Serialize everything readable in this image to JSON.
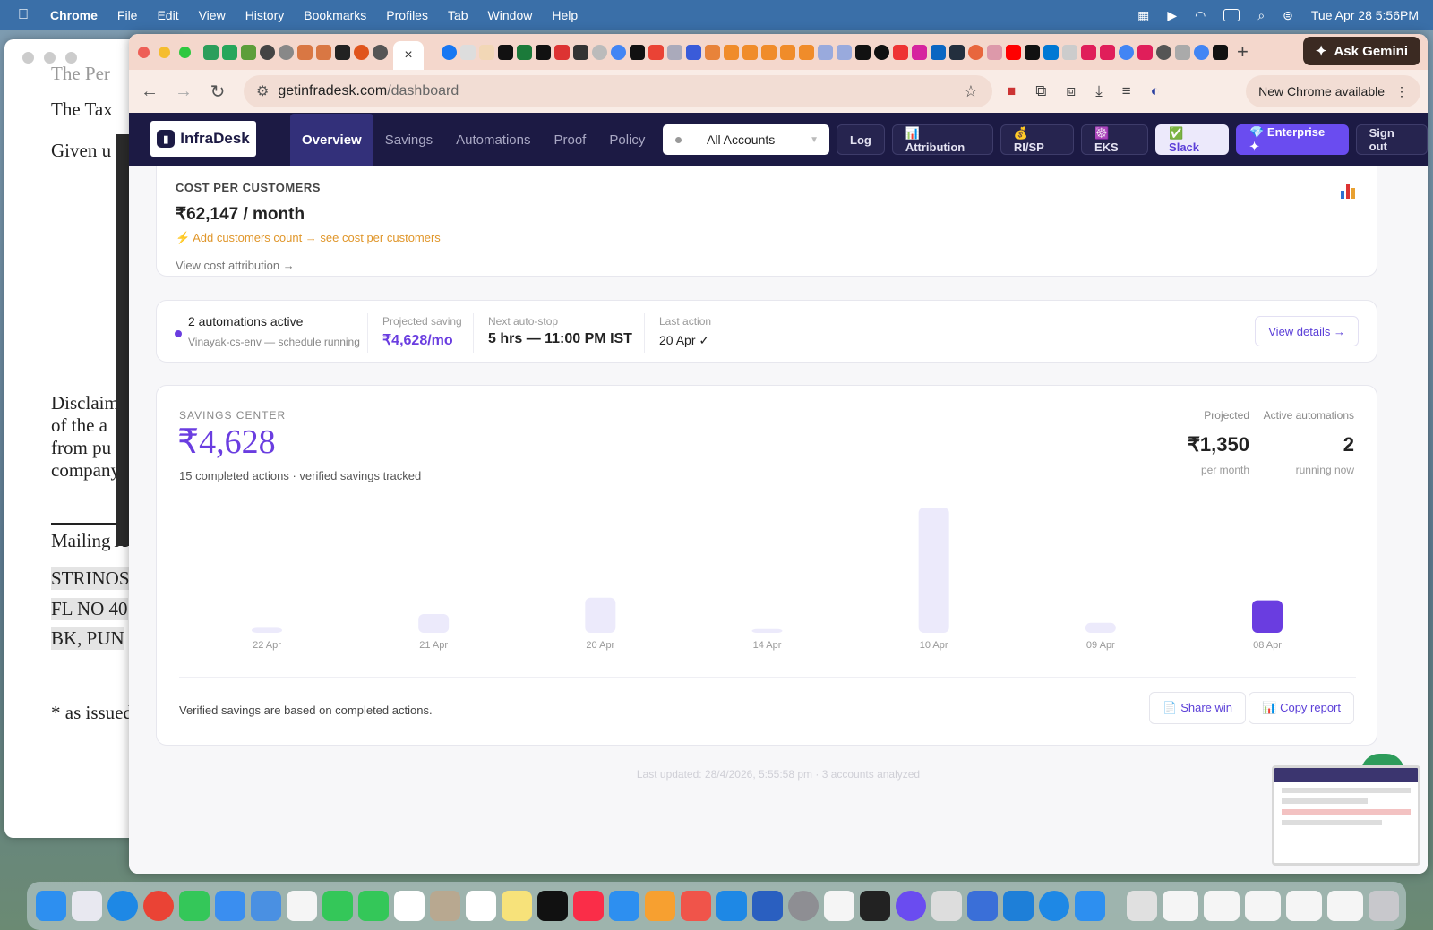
{
  "menubar": {
    "app": "Chrome",
    "items": [
      "File",
      "Edit",
      "View",
      "History",
      "Bookmarks",
      "Profiles",
      "Tab",
      "Window",
      "Help"
    ],
    "clock": "Tue Apr 28  5:56PM"
  },
  "docwin": {
    "lines": [
      "The Per",
      "The Tax",
      "Given u",
      "Disclaim",
      "of the a",
      "from pu",
      "company",
      "Mailing A",
      "STRINOS",
      "FL NO 40",
      "BK, PUN",
      "* as issued"
    ]
  },
  "chrome": {
    "url_host": "getinfradesk.com",
    "url_path": "/dashboard",
    "ask_gemini": "Ask Gemini",
    "new_chrome": "New Chrome available",
    "tab_close": "×",
    "new_tab": "+"
  },
  "nav": {
    "logo": "InfraDesk",
    "tabs": [
      "Overview",
      "Savings",
      "Automations",
      "Proof",
      "Policy"
    ],
    "account_select": "All Accounts",
    "buttons": [
      "Log",
      "📊 Attribution",
      "💰 RI/SP",
      "☸️ EKS",
      "✅ Slack",
      "💎 Enterprise ✦",
      "Sign out"
    ]
  },
  "cost_card": {
    "label": "COST PER CUSTOMERS",
    "amount": "₹62,147 / month",
    "hint": "⚡ Add customers count → see cost per customers",
    "link": "View cost attribution →"
  },
  "automation_card": {
    "title": "2 automations active",
    "subtitle": "Vinayak-cs-env — schedule running",
    "projected_label": "Projected saving",
    "projected_value": "₹4,628/mo",
    "next_label": "Next auto-stop",
    "next_value": "5 hrs — 11:00 PM IST",
    "last_label": "Last action",
    "last_value": "20 Apr ✓",
    "button": "View details →"
  },
  "savings": {
    "label": "SAVINGS CENTER",
    "amount": "₹4,628",
    "sub": "15 completed actions · verified savings tracked",
    "projected_label": "Projected",
    "projected_value": "₹1,350",
    "projected_unit": "per month",
    "active_label": "Active automations",
    "active_value": "2",
    "active_unit": "running now",
    "footer": "Verified savings are based on completed actions.",
    "share_btn": "📄 Share win",
    "copy_btn": "📊 Copy report",
    "colors": {
      "bar": "#eceafb",
      "highlight": "#6a3de0"
    }
  },
  "chart_data": {
    "type": "bar",
    "categories": [
      "22 Apr",
      "21 Apr",
      "20 Apr",
      "14 Apr",
      "10 Apr",
      "09 Apr",
      "08 Apr"
    ],
    "values": [
      4,
      15,
      28,
      3,
      100,
      8,
      26
    ],
    "highlight": "08 Apr",
    "xlabel": "",
    "ylabel": ""
  },
  "updated": "Last updated: 28/4/2026, 5:55:58 pm · 3 accounts analyzed"
}
